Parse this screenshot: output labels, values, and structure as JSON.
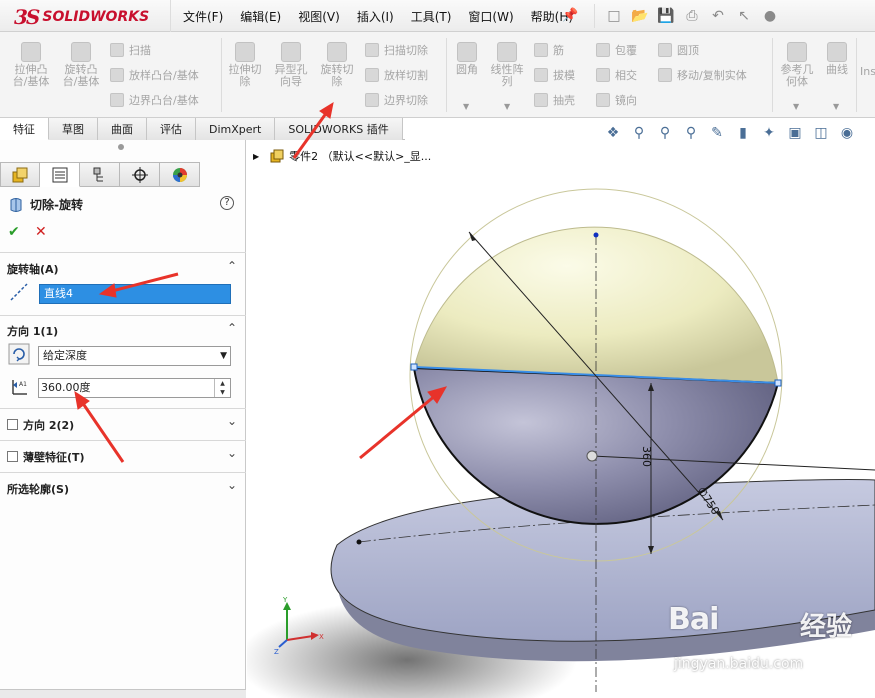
{
  "app": {
    "logo_ds": "3S",
    "logo_text": "SOLIDWORKS"
  },
  "menu": [
    "文件(F)",
    "编辑(E)",
    "视图(V)",
    "插入(I)",
    "工具(T)",
    "窗口(W)",
    "帮助(H)"
  ],
  "quick_icons": [
    "new-document-icon",
    "open-folder-icon",
    "save-icon",
    "print-icon",
    "undo-icon",
    "select-arrow-icon",
    "rebuild-icon"
  ],
  "ribbon": {
    "extrude_boss": "拉伸凸\n台/基体",
    "revolve_boss": "旋转凸\n台/基体",
    "sweep": "扫描",
    "loft_boss": "放样凸台/基体",
    "boundary_boss": "边界凸台/基体",
    "extrude_cut": "拉伸切\n除",
    "hole_wizard": "异型孔\n向导",
    "revolve_cut": "旋转切\n除",
    "sweep_cut": "扫描切除",
    "loft_cut": "放样切割",
    "boundary_cut": "边界切除",
    "fillet": "圆角",
    "linear_pattern": "线性阵\n列",
    "rib": "筋",
    "draft": "拔模",
    "shell": "抽壳",
    "wrap": "包覆",
    "intersect": "相交",
    "mirror": "镜向",
    "dome": "圆顶",
    "move_copy": "移动/复制实体",
    "ref_geometry": "参考几\n何体",
    "curves": "曲线",
    "instant3d": "Ins"
  },
  "command_tabs": [
    "特征",
    "草图",
    "曲面",
    "评估",
    "DimXpert",
    "SOLIDWORKS 插件"
  ],
  "property_manager": {
    "title": "切除-旋转",
    "help": "?",
    "ok": "✔",
    "cancel": "✕",
    "axis_section": "旋转轴(A)",
    "axis_value": "直线4",
    "dir1_section": "方向 1(1)",
    "dir1_type": "给定深度",
    "dir1_angle": "360.00度",
    "dir2_section": "方向 2(2)",
    "thin_section": "薄壁特征(T)",
    "contours_section": "所选轮廓(S)"
  },
  "tree": {
    "part_label": "零件2 （默认<<默认>_显..."
  },
  "viewport": {
    "dim_height": "360",
    "dim_diameter": "∅750"
  },
  "watermark": {
    "brand": "Bai",
    "brand2": "经验",
    "url": "jingyan.baidu.com"
  },
  "colors": {
    "sphere_top": "#f2f0c8",
    "sphere_bottom": "#9a9ab8",
    "disk": "#b8bdd8",
    "selection": "#2d8fe3",
    "arrow": "#e8332a"
  }
}
